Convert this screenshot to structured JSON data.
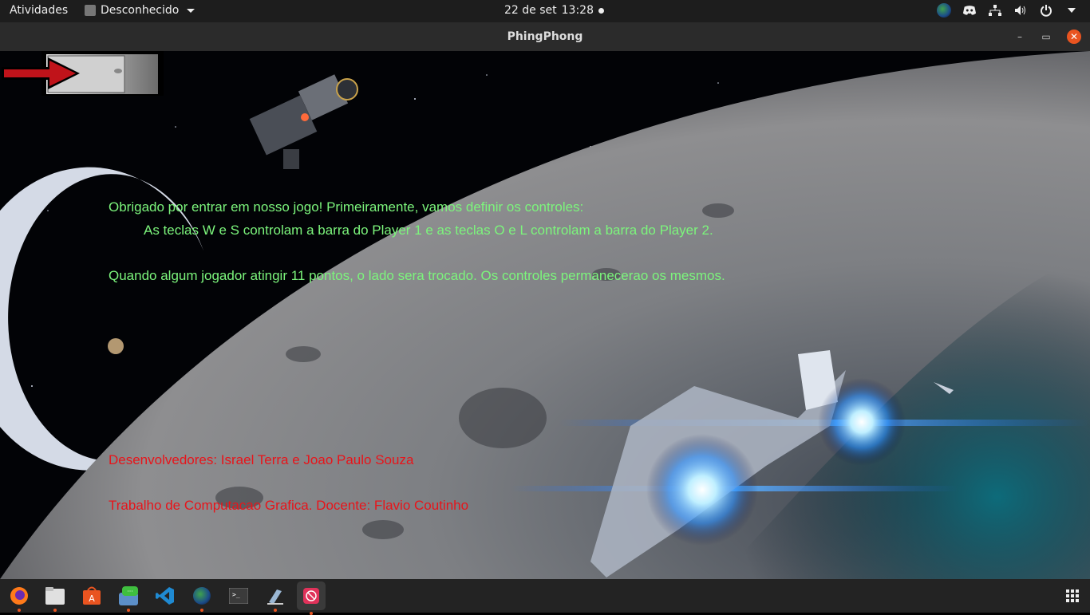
{
  "topbar": {
    "activities": "Atividades",
    "app_menu": "Desconhecido",
    "date": "22 de set",
    "time": "13:28"
  },
  "window": {
    "title": "PhingPhong"
  },
  "game": {
    "intro_line1": "Obrigado por entrar em nosso jogo! Primeiramente, vamos definir os controles:",
    "intro_line2": "As teclas W e S controlam a barra do Player 1 e as teclas O e L controlam a barra do Player 2.",
    "intro_line3": "Quando algum jogador atingir 11 pontos, o lado sera trocado. Os controles permanecerao os mesmos.",
    "credits_line1": "Desenvolvedores: Israel Terra e Joao Paulo Souza",
    "credits_line2": "Trabalho de Computacao Grafica. Docente: Flavio Coutinho",
    "colors": {
      "instructions": "#7cf57c",
      "credits": "#e8141a"
    }
  },
  "dock": {
    "apps": [
      "firefox-icon",
      "files-icon",
      "software-center-icon",
      "chat-icon",
      "vscode-icon",
      "chrome-icon",
      "terminal-icon",
      "inkscape-icon",
      "phingphong-icon"
    ]
  }
}
